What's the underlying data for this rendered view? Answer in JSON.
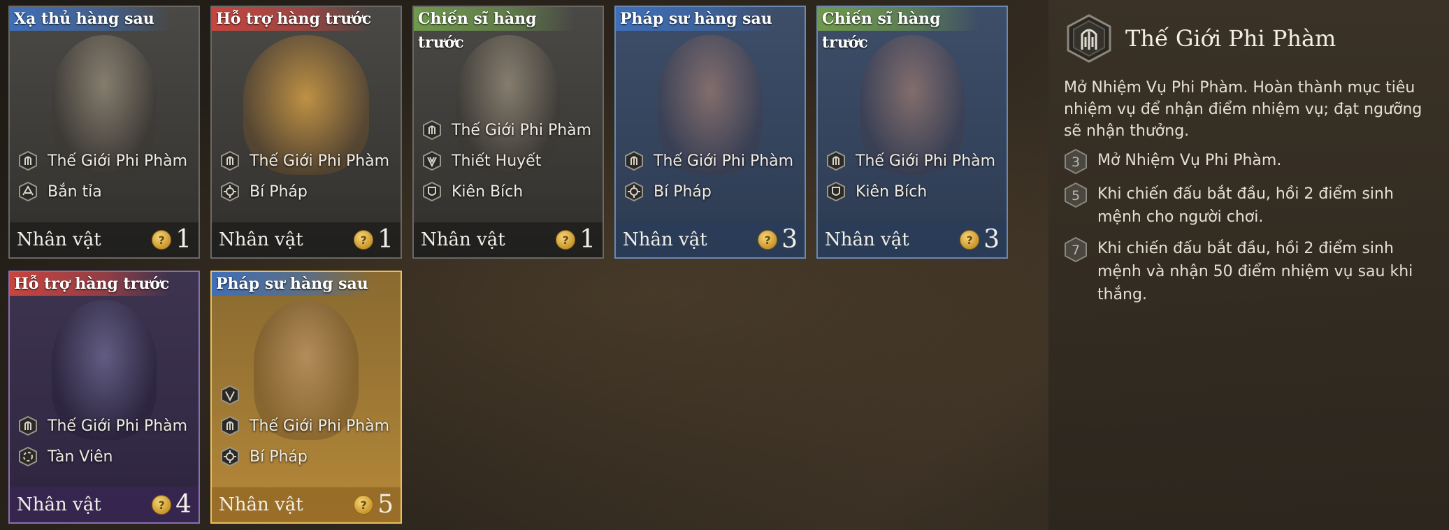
{
  "cards": [
    {
      "role": "Xạ thủ hàng sau",
      "role_color": "#3f6fb8",
      "rarity": "grey",
      "traits": [
        {
          "icon": "the-gioi-phi-pham-icon",
          "label": "Thế Giới Phi Phàm"
        },
        {
          "icon": "ban-tia-icon",
          "label": "Bắn tỉa"
        }
      ],
      "type": "Nhân vật",
      "cost": "1"
    },
    {
      "role": "Hỗ trợ hàng trước",
      "role_color": "#c8453f",
      "rarity": "grey",
      "traits": [
        {
          "icon": "the-gioi-phi-pham-icon",
          "label": "Thế Giới Phi Phàm"
        },
        {
          "icon": "bi-phap-icon",
          "label": "Bí Pháp"
        }
      ],
      "type": "Nhân vật",
      "cost": "1"
    },
    {
      "role": "Chiến sĩ hàng trước",
      "role_color": "#6f9a4c",
      "rarity": "grey",
      "traits": [
        {
          "icon": "the-gioi-phi-pham-icon",
          "label": "Thế Giới Phi Phàm"
        },
        {
          "icon": "thiet-huyet-icon",
          "label": "Thiết Huyết"
        },
        {
          "icon": "kien-bich-icon",
          "label": "Kiên Bích"
        }
      ],
      "type": "Nhân vật",
      "cost": "1"
    },
    {
      "role": "Pháp sư hàng sau",
      "role_color": "#3f6fb8",
      "rarity": "blue",
      "traits": [
        {
          "icon": "the-gioi-phi-pham-icon",
          "label": "Thế Giới Phi Phàm"
        },
        {
          "icon": "bi-phap-icon",
          "label": "Bí Pháp"
        }
      ],
      "type": "Nhân vật",
      "cost": "3"
    },
    {
      "role": "Chiến sĩ hàng trước",
      "role_color": "#6f9a4c",
      "rarity": "blue",
      "traits": [
        {
          "icon": "the-gioi-phi-pham-icon",
          "label": "Thế Giới Phi Phàm"
        },
        {
          "icon": "kien-bich-icon",
          "label": "Kiên Bích"
        }
      ],
      "type": "Nhân vật",
      "cost": "3"
    },
    {
      "role": "Hỗ trợ hàng trước",
      "role_color": "#c8453f",
      "rarity": "purple",
      "traits": [
        {
          "icon": "the-gioi-phi-pham-icon",
          "label": "Thế Giới Phi Phàm"
        },
        {
          "icon": "tan-vien-icon",
          "label": "Tàn Viên"
        }
      ],
      "type": "Nhân vật",
      "cost": "4"
    },
    {
      "role": "Pháp sư hàng sau",
      "role_color": "#3f6fb8",
      "rarity": "gold",
      "traits": [
        {
          "icon": "extra-trait-icon",
          "label": ""
        },
        {
          "icon": "the-gioi-phi-pham-icon",
          "label": "Thế Giới Phi Phàm"
        },
        {
          "icon": "bi-phap-icon",
          "label": "Bí Pháp"
        }
      ],
      "type": "Nhân vật",
      "cost": "5"
    }
  ],
  "panel": {
    "title": "Thế Giới Phi Phàm",
    "emblem_icon": "the-gioi-phi-pham-emblem-icon",
    "description": "Mở Nhiệm Vụ Phi Phàm. Hoàn thành mục tiêu nhiệm vụ để nhận điểm nhiệm vụ; đạt ngưỡng sẽ nhận thưởng.",
    "tiers": [
      {
        "count": "3",
        "text": "Mở Nhiệm Vụ Phi Phàm."
      },
      {
        "count": "5",
        "text": "Khi chiến đấu bắt đầu, hồi 2 điểm sinh mệnh cho người chơi."
      },
      {
        "count": "7",
        "text": "Khi chiến đấu bắt đầu, hồi 2 điểm sinh mệnh và nhận 50 điểm nhiệm vụ sau khi thắng."
      }
    ]
  }
}
